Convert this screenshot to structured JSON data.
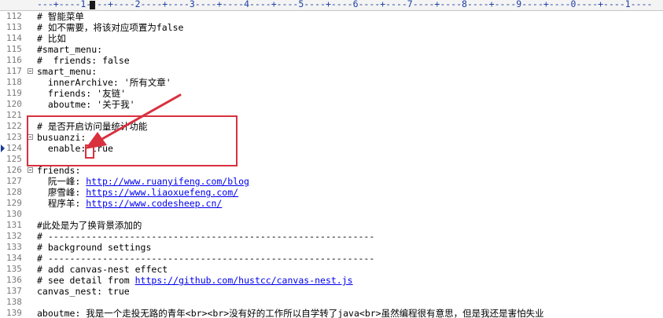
{
  "ruler": "---+----1----+----2----+----3----+----4----+----5----+----6----+----7----+----8----+----9----+----0----+----1----",
  "lines": [
    {
      "num": "112",
      "text": "# 智能菜单"
    },
    {
      "num": "113",
      "text": "# 如不需要，将该对应项置为false"
    },
    {
      "num": "114",
      "text": "# 比如"
    },
    {
      "num": "115",
      "text": "#smart_menu:"
    },
    {
      "num": "116",
      "text": "#  friends: false"
    },
    {
      "num": "117",
      "text": "smart_menu:"
    },
    {
      "num": "118",
      "text": "  innerArchive: '所有文章'"
    },
    {
      "num": "119",
      "text": "  friends: '友链'"
    },
    {
      "num": "120",
      "text": "  aboutme: '关于我'"
    },
    {
      "num": "121",
      "text": ""
    },
    {
      "num": "122",
      "text": "# 是否开启访问量统计功能"
    },
    {
      "num": "123",
      "text": "busuanzi:"
    },
    {
      "num": "124",
      "text": "  enable: true"
    },
    {
      "num": "125",
      "text": ""
    },
    {
      "num": "126",
      "text": "friends:"
    },
    {
      "num": "127",
      "text": "  阮一峰: ",
      "link": "http://www.ruanyifeng.com/blog"
    },
    {
      "num": "128",
      "text": "  廖雪峰: ",
      "link": "https://www.liaoxuefeng.com/"
    },
    {
      "num": "129",
      "text": "  程序羊: ",
      "link": "https://www.codesheep.cn/"
    },
    {
      "num": "130",
      "text": ""
    },
    {
      "num": "131",
      "text": "#此处是为了换背景添加的"
    },
    {
      "num": "132",
      "text": "# ------------------------------------------------------------"
    },
    {
      "num": "133",
      "text": "# background settings"
    },
    {
      "num": "134",
      "text": "# ------------------------------------------------------------"
    },
    {
      "num": "135",
      "text": "# add canvas-nest effect"
    },
    {
      "num": "136",
      "text": "# see detail from ",
      "link": "https://github.com/hustcc/canvas-nest.js"
    },
    {
      "num": "137",
      "text": "canvas_nest: true"
    },
    {
      "num": "138",
      "text": ""
    },
    {
      "num": "139",
      "text": "aboutme: 我是一个走投无路的青年<br><br>没有好的工作所以自学转了java<br>虽然编程很有意思，但是我还是害怕失业"
    }
  ]
}
